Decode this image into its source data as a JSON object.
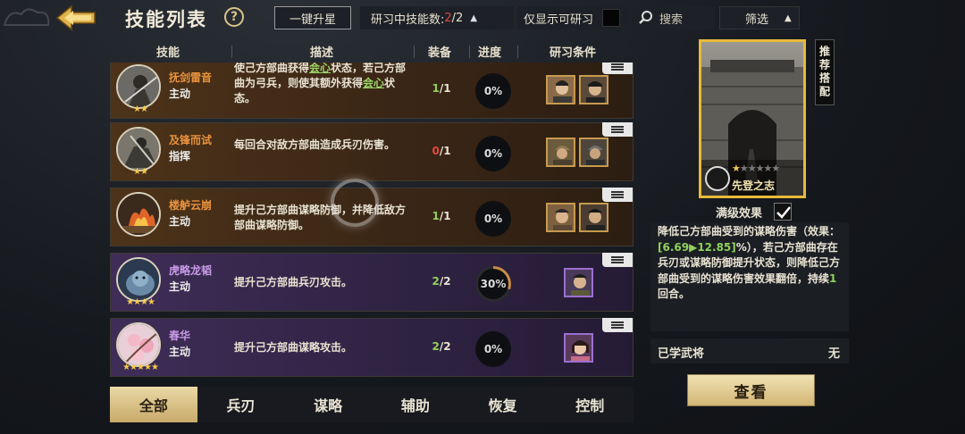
{
  "header": {
    "title": "技能列表",
    "help": "?",
    "upgrade_all": "一键升星",
    "researching_label": "研习中技能数:",
    "researching_current": "2",
    "researching_total": "/2",
    "only_show_label": "仅显示可研习",
    "search_label": "搜索",
    "filter_label": "筛选"
  },
  "columns": {
    "skill": "技能",
    "desc": "描述",
    "equip": "装备",
    "progress": "进度",
    "condition": "研习条件"
  },
  "skills": [
    {
      "name": "抚剑雷音",
      "type": "主动",
      "stars": "★★",
      "desc_parts": [
        "使己方部曲获得",
        "会心",
        "状态，若己方部曲为弓兵，则使其额外获得",
        "会心",
        "状态。"
      ],
      "equip_used": "1",
      "equip_total": "/1",
      "progress": "0%"
    },
    {
      "name": "及锋而试",
      "type": "指挥",
      "stars": "★★",
      "desc": "每回合对敌方部曲造成兵刃伤害。",
      "equip_used": "0",
      "equip_total": "/1",
      "progress": "0%"
    },
    {
      "name": "楼舻云崩",
      "type": "主动",
      "stars": "",
      "desc": "提升己方部曲谋略防御，并降低敌方部曲谋略防御。",
      "equip_used": "1",
      "equip_total": "/1",
      "progress": "0%"
    },
    {
      "name": "虎略龙韬",
      "type": "主动",
      "stars": "★★★★",
      "desc": "提升己方部曲兵刃攻击。",
      "equip_used": "2",
      "equip_total": "/2",
      "progress": "30%",
      "progress_value": 0.3
    },
    {
      "name": "春华",
      "type": "主动",
      "stars": "★★★★★",
      "desc": "提升己方部曲谋略攻击。",
      "equip_used": "2",
      "equip_total": "/2",
      "progress": "0%"
    }
  ],
  "tabs": [
    "全部",
    "兵刃",
    "谋略",
    "辅助",
    "恢复",
    "控制"
  ],
  "active_tab": "全部",
  "card": {
    "recommend": "推荐搭配",
    "name": "先登之志",
    "stars_on": "★",
    "stars_off": "★★★★★",
    "star_count": 1
  },
  "max_effect_label": "满级效果",
  "effect": {
    "p1": "降低己方部曲受到的谋略伤害（效果：",
    "val": "[6.69▶12.85]",
    "p2": "%），若己方部曲存在兵刃或谋略防御提升状态，则降低己方部曲受到的谋略伤害效果翻倍，持续",
    "turns": "1",
    "p3": "回合。"
  },
  "learned": {
    "label": "已学武将",
    "value": "无"
  },
  "view_button": "查看",
  "colors": {
    "accent_gold": "#e8b93a",
    "green": "#8fd15c",
    "red": "#e04a3c"
  }
}
